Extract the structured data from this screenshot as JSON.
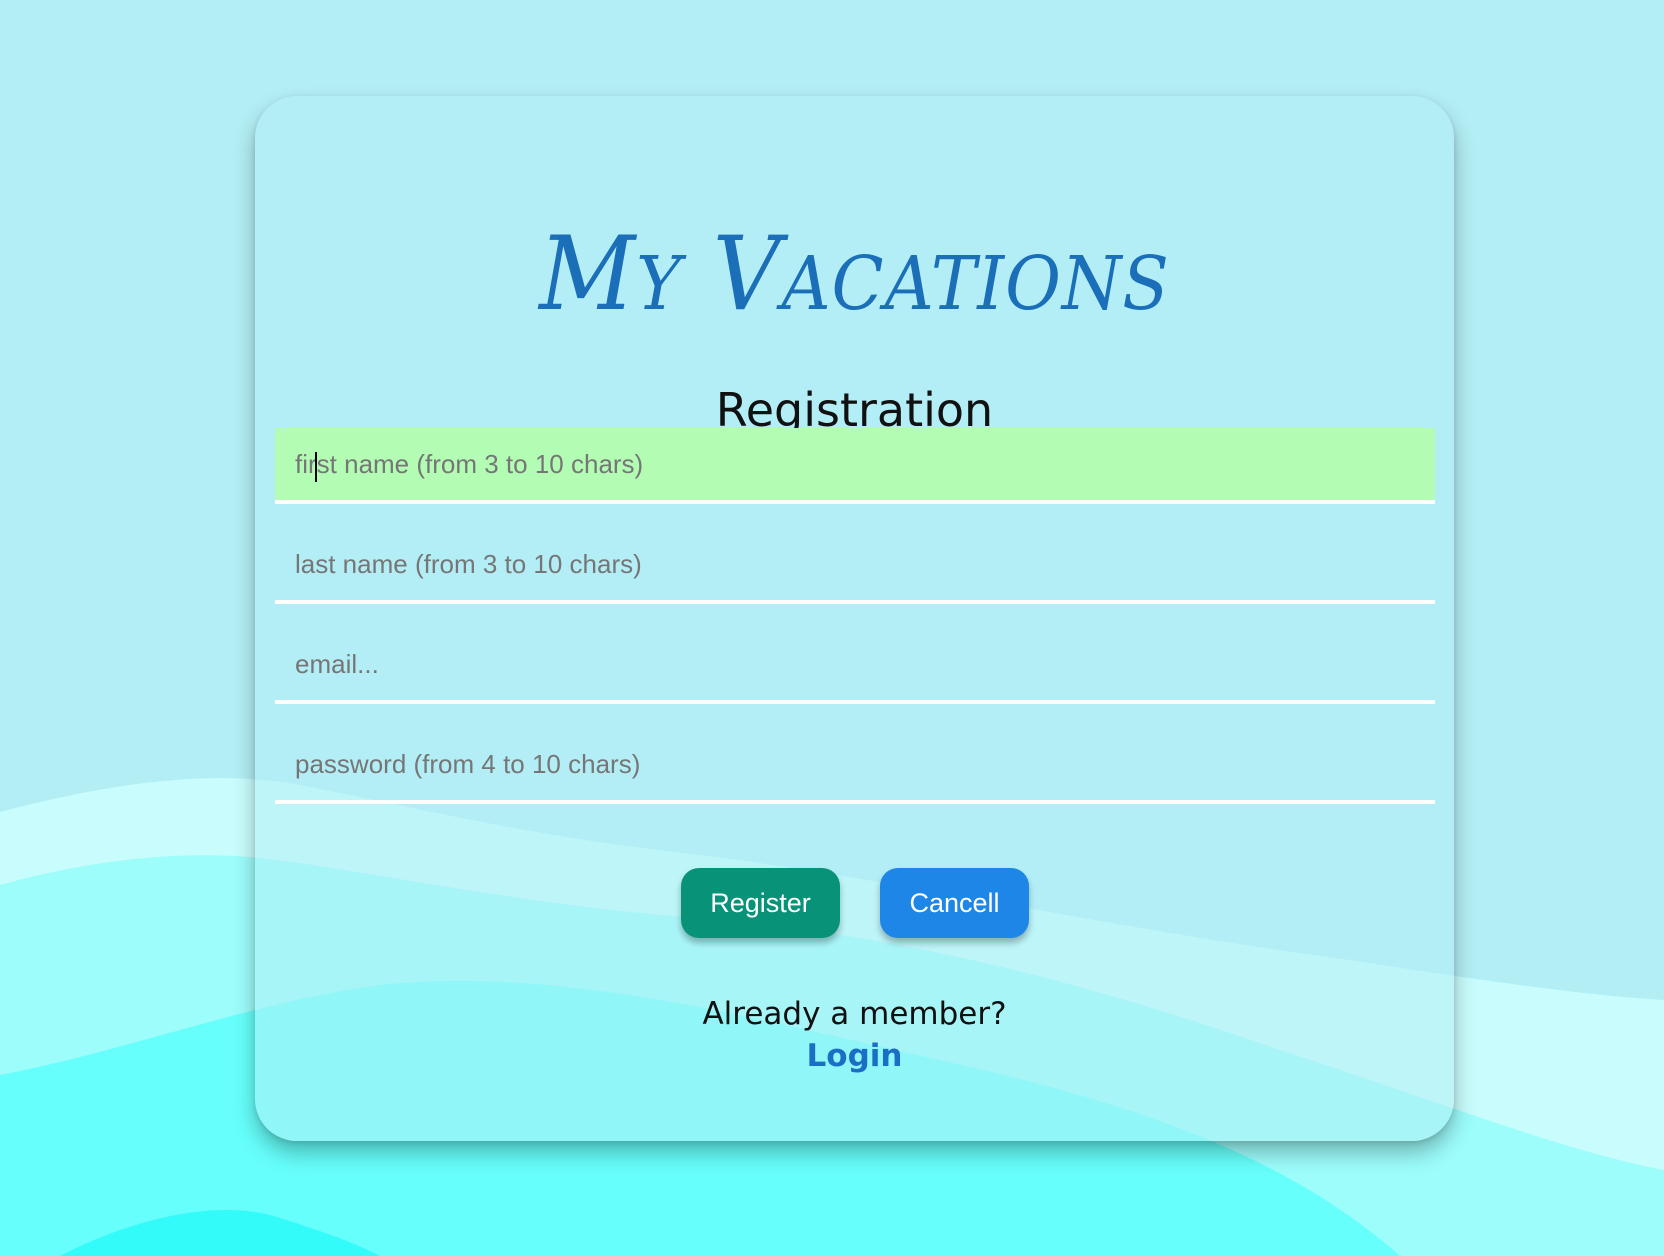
{
  "app": {
    "title": "My Vacations",
    "title_first": "M",
    "title_first_rest": "Y",
    "title_second": "V",
    "title_second_rest": "ACATIONS"
  },
  "page": {
    "subtitle": "Registration"
  },
  "form": {
    "first_name_placeholder": "first name (from 3 to 10 chars)",
    "last_name_placeholder": "last name (from 3 to 10 chars)",
    "email_placeholder": "email...",
    "password_placeholder": "password (from 4 to 10 chars)",
    "first_name_value": "",
    "last_name_value": "",
    "email_value": "",
    "password_value": ""
  },
  "actions": {
    "register_label": "Register",
    "cancel_label": "Cancell"
  },
  "footer": {
    "member_text": "Already a member?",
    "login_label": "Login"
  },
  "colors": {
    "background": "#b3eef5",
    "brand": "#1a6fb8",
    "active_field": "#b3fcb3",
    "register_button": "#089379",
    "cancel_button": "#1e86e6",
    "link": "#1a6fc4"
  }
}
